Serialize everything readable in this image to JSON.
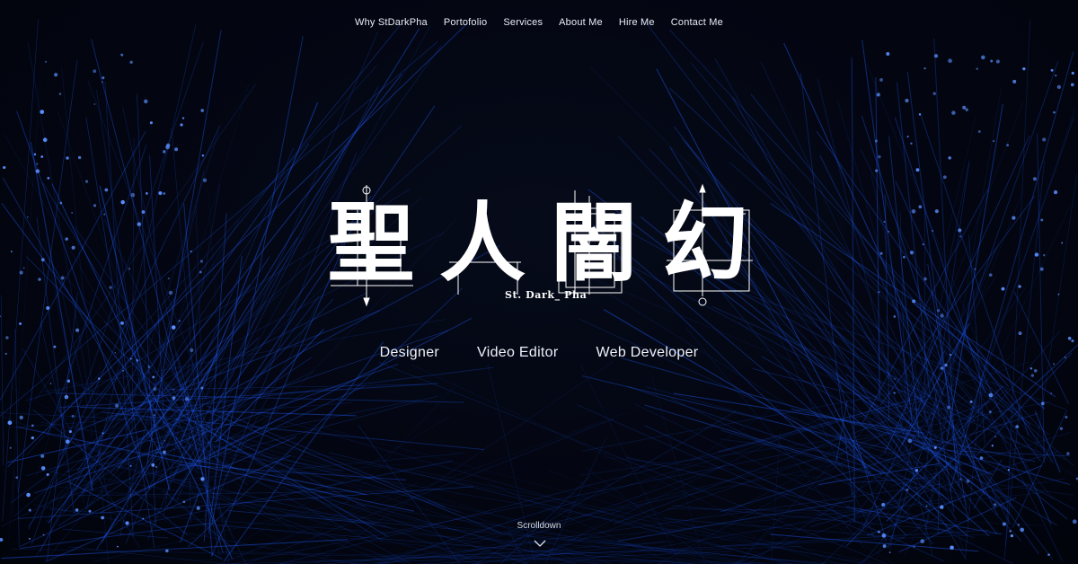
{
  "nav": {
    "items": [
      {
        "label": "Why StDarkPha",
        "name": "nav-why-stdarkpha"
      },
      {
        "label": "Portofolio",
        "name": "nav-portofolio"
      },
      {
        "label": "Services",
        "name": "nav-services"
      },
      {
        "label": "About Me",
        "name": "nav-about-me"
      },
      {
        "label": "Hire Me",
        "name": "nav-hire-me"
      },
      {
        "label": "Contact Me",
        "name": "nav-contact-me"
      }
    ]
  },
  "hero": {
    "logo_chars": [
      "聖",
      "人",
      "闇",
      "幻"
    ],
    "logo_subtitle": "St. Dark_ Pha",
    "roles": [
      "Designer",
      "Video Editor",
      "Web Developer"
    ]
  },
  "scroll": {
    "label": "Scrolldown",
    "icon": "chevron-down-icon"
  },
  "colors": {
    "background": "#030611",
    "accent_blue": "#1f5cff",
    "text": "#e9edf6"
  }
}
